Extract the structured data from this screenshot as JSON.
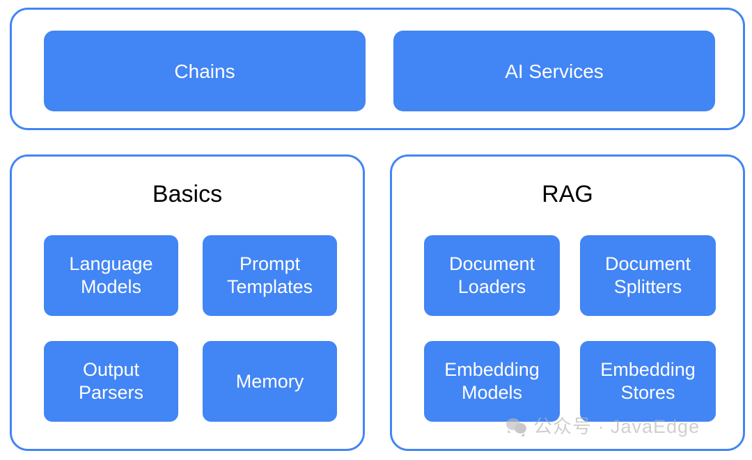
{
  "diagram": {
    "type": "block-diagram",
    "title_visible": false,
    "accent_color": "#4285f4",
    "box_text_color": "#ffffff",
    "title_text_color": "#000000",
    "background": "#ffffff"
  },
  "top_panel": {
    "boxes": [
      {
        "label": "Chains"
      },
      {
        "label": "AI Services"
      }
    ]
  },
  "basics_panel": {
    "title": "Basics",
    "boxes": [
      {
        "label": "Language\nModels"
      },
      {
        "label": "Prompt\nTemplates"
      },
      {
        "label": "Output\nParsers"
      },
      {
        "label": "Memory"
      }
    ]
  },
  "rag_panel": {
    "title": "RAG",
    "boxes": [
      {
        "label": "Document\nLoaders"
      },
      {
        "label": "Document\nSplitters"
      },
      {
        "label": "Embedding\nModels"
      },
      {
        "label": "Embedding\nStores"
      }
    ]
  },
  "watermark": {
    "icon": "wechat-icon",
    "text": "公众号 · JavaEdge",
    "color": "#b3b3b3"
  }
}
